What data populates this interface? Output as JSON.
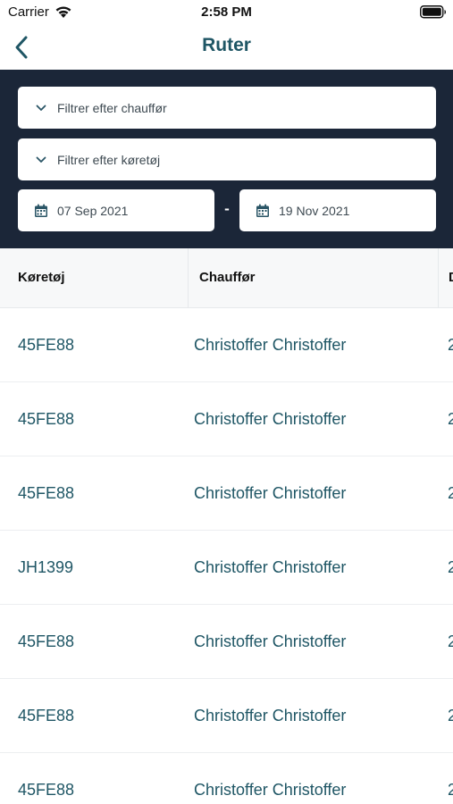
{
  "status_bar": {
    "carrier": "Carrier",
    "time": "2:58 PM"
  },
  "nav": {
    "title": "Ruter"
  },
  "filters": {
    "driver_placeholder": "Filtrer efter chauffør",
    "vehicle_placeholder": "Filtrer efter køretøj",
    "start_date": "07 Sep 2021",
    "end_date": "19 Nov 2021",
    "separator": "-"
  },
  "table": {
    "columns": [
      "Køretøj",
      "Chauffør",
      "D"
    ],
    "rows": [
      {
        "vehicle": "45FE88",
        "driver": "Christoffer Christoffer",
        "partial": "2"
      },
      {
        "vehicle": "45FE88",
        "driver": "Christoffer Christoffer",
        "partial": "2"
      },
      {
        "vehicle": "45FE88",
        "driver": "Christoffer Christoffer",
        "partial": "2"
      },
      {
        "vehicle": "JH1399",
        "driver": "Christoffer Christoffer",
        "partial": "2"
      },
      {
        "vehicle": "45FE88",
        "driver": "Christoffer Christoffer",
        "partial": "2"
      },
      {
        "vehicle": "45FE88",
        "driver": "Christoffer Christoffer",
        "partial": "2"
      },
      {
        "vehicle": "45FE88",
        "driver": "Christoffer Christoffer",
        "partial": "2"
      }
    ]
  },
  "colors": {
    "accent": "#1f5665",
    "panel": "#1b2638"
  },
  "icons": [
    "wifi-icon",
    "battery-icon",
    "back-chevron-icon",
    "chevron-down-icon",
    "calendar-icon"
  ]
}
